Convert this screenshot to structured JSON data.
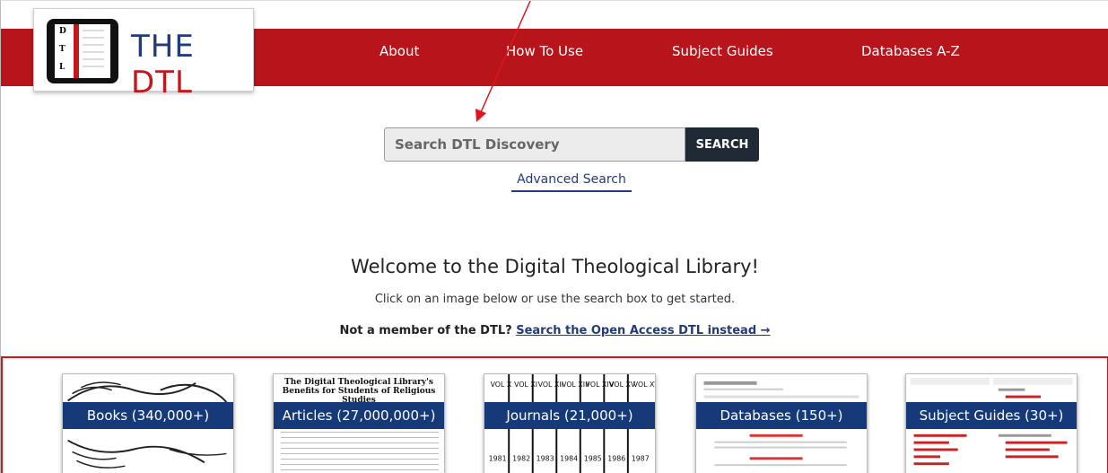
{
  "logo": {
    "text_prefix": "THE ",
    "text_suffix": "DTL",
    "letters": [
      "D",
      "T",
      "L"
    ]
  },
  "nav": {
    "items": [
      "About",
      "How To Use",
      "Subject Guides",
      "Databases A-Z"
    ]
  },
  "search": {
    "placeholder": "Search DTL Discovery",
    "button_label": "SEARCH",
    "advanced_label": "Advanced Search"
  },
  "welcome": {
    "title": "Welcome to the Digital Theological Library!",
    "subtitle": "Click on an image below or use the search box to get started.",
    "member_prefix": "Not a member of the DTL? ",
    "member_link": "Search the Open Access DTL instead →"
  },
  "tiles": [
    {
      "label": "Books (340,000+)"
    },
    {
      "label": "Articles (27,000,000+)",
      "mini_title": "The Digital Theological Library's Benefits for Students of Religious Studies"
    },
    {
      "label": "Journals (21,000+)",
      "vols": [
        "VOL X",
        "VOL XI",
        "VOL XII",
        "VOL XIII",
        "VOL XIV",
        "VOL XV",
        "VOL XVI"
      ],
      "years": [
        "1981",
        "1982",
        "1983",
        "1984",
        "1985",
        "1986",
        "1987"
      ]
    },
    {
      "label": "Databases (150+)"
    },
    {
      "label": "Subject Guides (30+)"
    }
  ],
  "colors": {
    "nav_red": "#b8141b",
    "logo_blue": "#223b7c",
    "tile_blue": "#16397a",
    "search_dark": "#1f2a36"
  }
}
